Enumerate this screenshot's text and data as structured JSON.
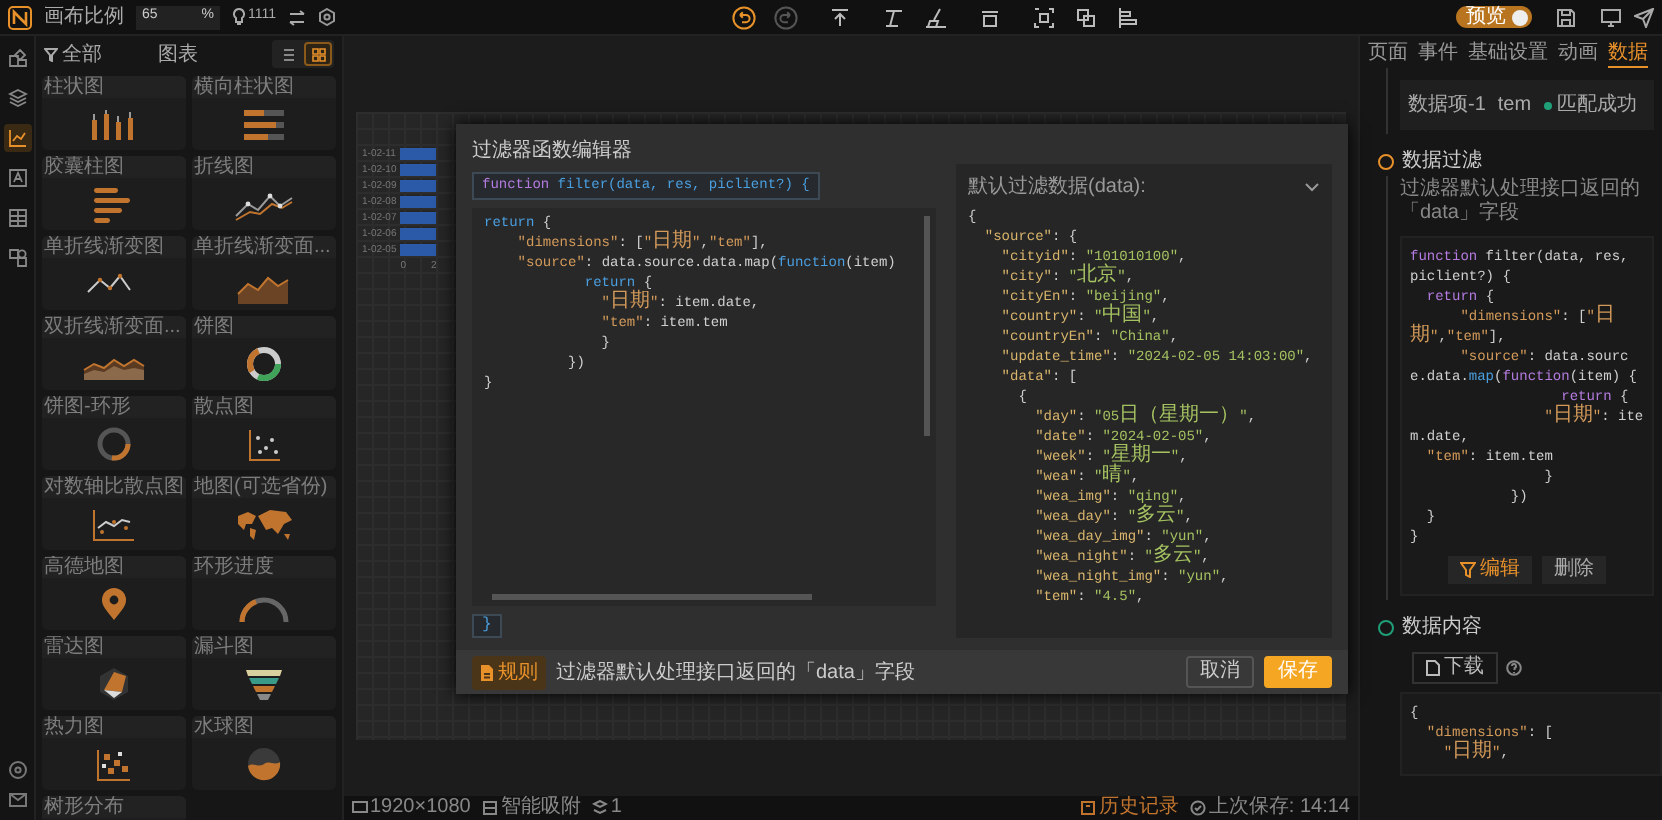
{
  "topbar": {
    "scale_label": "画布比例",
    "scale_value": "65",
    "scale_unit": "%",
    "count": "1111",
    "preview_label": "预览",
    "preview_on": true,
    "tools": [
      {
        "kind": "undo",
        "disabled": false
      },
      {
        "kind": "redo",
        "disabled": true
      },
      {
        "kind": "upload",
        "disabled": false
      },
      {
        "kind": "format",
        "disabled": false
      },
      {
        "kind": "brush",
        "disabled": false
      },
      {
        "kind": "layer",
        "disabled": false
      },
      {
        "kind": "group",
        "disabled": false
      },
      {
        "kind": "ungroup",
        "disabled": false
      },
      {
        "kind": "align",
        "disabled": false
      }
    ]
  },
  "rail": [
    {
      "kind": "blocks",
      "selected": false
    },
    {
      "kind": "layers",
      "selected": false
    },
    {
      "kind": "chart",
      "selected": true
    },
    {
      "kind": "text",
      "selected": false
    },
    {
      "kind": "table",
      "selected": false
    },
    {
      "kind": "shapes",
      "selected": false
    }
  ],
  "component_panel": {
    "filter": "全部",
    "title": "图表",
    "views": [
      {
        "kind": "list",
        "selected": false
      },
      {
        "kind": "grid",
        "selected": true
      }
    ],
    "items": [
      {
        "label": "柱状图",
        "kind": "bars"
      },
      {
        "label": "横向柱状图",
        "kind": "hbars"
      },
      {
        "label": "胶囊柱图",
        "kind": "capsule"
      },
      {
        "label": "折线图",
        "kind": "line"
      },
      {
        "label": "单折线渐变图",
        "kind": "line2"
      },
      {
        "label": "单折线渐变面...",
        "kind": "area"
      },
      {
        "label": "双折线渐变面...",
        "kind": "area2"
      },
      {
        "label": "饼图",
        "kind": "pie"
      },
      {
        "label": "饼图-环形",
        "kind": "donut"
      },
      {
        "label": "散点图",
        "kind": "scatter"
      },
      {
        "label": "对数轴比散点图",
        "kind": "scatterlog"
      },
      {
        "label": "地图(可选省份)",
        "kind": "map"
      },
      {
        "label": "高德地图",
        "kind": "pin"
      },
      {
        "label": "环形进度",
        "kind": "gauge"
      },
      {
        "label": "雷达图",
        "kind": "radar"
      },
      {
        "label": "漏斗图",
        "kind": "funnel"
      },
      {
        "label": "热力图",
        "kind": "heat"
      },
      {
        "label": "水球图",
        "kind": "ball"
      },
      {
        "label": "树形分布"
      }
    ]
  },
  "canvas_chart": {
    "labels": [
      "1-02-11",
      "1-02-10",
      "1-02-09",
      "1-02-08",
      "1-02-07",
      "1-02-06",
      "1-02-05"
    ],
    "ticks": [
      "0",
      "2"
    ]
  },
  "dialog": {
    "title": "过滤器函数编辑器",
    "signature": [
      {
        "kind": "fn",
        "text": "function"
      },
      {
        "kind": "kw",
        "text": " filter(data, res, piclient?) {"
      }
    ],
    "code": [
      [
        {
          "kind": "kw",
          "text": "return"
        },
        {
          "kind": "pl",
          "text": " {"
        }
      ],
      [
        {
          "kind": "str",
          "text": "    \"dimensions\""
        },
        {
          "kind": "pl",
          "text": ": ["
        },
        {
          "kind": "str",
          "text": "\"日期\""
        },
        {
          "kind": "pl",
          "text": ","
        },
        {
          "kind": "str",
          "text": "\"tem\""
        },
        {
          "kind": "pl",
          "text": "],"
        }
      ],
      [
        {
          "kind": "str",
          "text": "    \"source\""
        },
        {
          "kind": "pl",
          "text": ": data.source.data.map("
        },
        {
          "kind": "kw",
          "text": "function"
        },
        {
          "kind": "pl",
          "text": "(item)"
        }
      ],
      [
        {
          "kind": "kw",
          "text": "            return"
        },
        {
          "kind": "pl",
          "text": " {"
        }
      ],
      [
        {
          "kind": "str",
          "text": "              \"日期\""
        },
        {
          "kind": "pl",
          "text": ": item.date,"
        }
      ],
      [
        {
          "kind": "str",
          "text": "              \"tem\""
        },
        {
          "kind": "pl",
          "text": ": item.tem"
        }
      ],
      [
        {
          "kind": "pl",
          "text": "              }"
        }
      ],
      [
        {
          "kind": "pl",
          "text": "          })"
        }
      ],
      [
        {
          "kind": "pl",
          "text": "}"
        }
      ]
    ],
    "closing": "}",
    "data_title": "默认过滤数据(data):",
    "data_lines": [
      [
        {
          "kind": "pl",
          "text": "{"
        }
      ],
      [
        {
          "kind": "k",
          "text": "  \"source\""
        },
        {
          "kind": "pl",
          "text": ": {"
        }
      ],
      [
        {
          "kind": "k",
          "text": "    \"cityid\""
        },
        {
          "kind": "pl",
          "text": ": "
        },
        {
          "kind": "v",
          "text": "\"101010100\""
        },
        {
          "kind": "pl",
          "text": ","
        }
      ],
      [
        {
          "kind": "k",
          "text": "    \"city\""
        },
        {
          "kind": "pl",
          "text": ": "
        },
        {
          "kind": "v",
          "text": "\"北京\""
        },
        {
          "kind": "pl",
          "text": ","
        }
      ],
      [
        {
          "kind": "k",
          "text": "    \"cityEn\""
        },
        {
          "kind": "pl",
          "text": ": "
        },
        {
          "kind": "v",
          "text": "\"beijing\""
        },
        {
          "kind": "pl",
          "text": ","
        }
      ],
      [
        {
          "kind": "k",
          "text": "    \"country\""
        },
        {
          "kind": "pl",
          "text": ": "
        },
        {
          "kind": "v",
          "text": "\"中国\""
        },
        {
          "kind": "pl",
          "text": ","
        }
      ],
      [
        {
          "kind": "k",
          "text": "    \"countryEn\""
        },
        {
          "kind": "pl",
          "text": ": "
        },
        {
          "kind": "v",
          "text": "\"China\""
        },
        {
          "kind": "pl",
          "text": ","
        }
      ],
      [
        {
          "kind": "k",
          "text": "    \"update_time\""
        },
        {
          "kind": "pl",
          "text": ": "
        },
        {
          "kind": "v",
          "text": "\"2024-02-05 14:03:00\""
        },
        {
          "kind": "pl",
          "text": ","
        }
      ],
      [
        {
          "kind": "k",
          "text": "    \"data\""
        },
        {
          "kind": "pl",
          "text": ": ["
        }
      ],
      [
        {
          "kind": "pl",
          "text": "      {"
        }
      ],
      [
        {
          "kind": "k",
          "text": "        \"day\""
        },
        {
          "kind": "pl",
          "text": ": "
        },
        {
          "kind": "v",
          "text": "\"05日（星期一）\""
        },
        {
          "kind": "pl",
          "text": ","
        }
      ],
      [
        {
          "kind": "k",
          "text": "        \"date\""
        },
        {
          "kind": "pl",
          "text": ": "
        },
        {
          "kind": "v",
          "text": "\"2024-02-05\""
        },
        {
          "kind": "pl",
          "text": ","
        }
      ],
      [
        {
          "kind": "k",
          "text": "        \"week\""
        },
        {
          "kind": "pl",
          "text": ": "
        },
        {
          "kind": "v",
          "text": "\"星期一\""
        },
        {
          "kind": "pl",
          "text": ","
        }
      ],
      [
        {
          "kind": "k",
          "text": "        \"wea\""
        },
        {
          "kind": "pl",
          "text": ": "
        },
        {
          "kind": "v",
          "text": "\"晴\""
        },
        {
          "kind": "pl",
          "text": ","
        }
      ],
      [
        {
          "kind": "k",
          "text": "        \"wea_img\""
        },
        {
          "kind": "pl",
          "text": ": "
        },
        {
          "kind": "v",
          "text": "\"qing\""
        },
        {
          "kind": "pl",
          "text": ","
        }
      ],
      [
        {
          "kind": "k",
          "text": "        \"wea_day\""
        },
        {
          "kind": "pl",
          "text": ": "
        },
        {
          "kind": "v",
          "text": "\"多云\""
        },
        {
          "kind": "pl",
          "text": ","
        }
      ],
      [
        {
          "kind": "k",
          "text": "        \"wea_day_img\""
        },
        {
          "kind": "pl",
          "text": ": "
        },
        {
          "kind": "v",
          "text": "\"yun\""
        },
        {
          "kind": "pl",
          "text": ","
        }
      ],
      [
        {
          "kind": "k",
          "text": "        \"wea_night\""
        },
        {
          "kind": "pl",
          "text": ": "
        },
        {
          "kind": "v",
          "text": "\"多云\""
        },
        {
          "kind": "pl",
          "text": ","
        }
      ],
      [
        {
          "kind": "k",
          "text": "        \"wea_night_img\""
        },
        {
          "kind": "pl",
          "text": ": "
        },
        {
          "kind": "v",
          "text": "\"yun\""
        },
        {
          "kind": "pl",
          "text": ","
        }
      ],
      [
        {
          "kind": "k",
          "text": "        \"tem\""
        },
        {
          "kind": "pl",
          "text": ": "
        },
        {
          "kind": "v",
          "text": "\"4.5\""
        },
        {
          "kind": "pl",
          "text": ","
        }
      ]
    ],
    "rule_badge": "规则",
    "rule_text": "过滤器默认处理接口返回的「data」字段",
    "cancel": "取消",
    "save": "保存"
  },
  "right_panel": {
    "tabs": [
      {
        "label": "页面",
        "selected": false
      },
      {
        "label": "事件",
        "selected": false
      },
      {
        "label": "基础设置",
        "selected": false
      },
      {
        "label": "动画",
        "selected": false
      },
      {
        "label": "数据",
        "selected": true
      }
    ],
    "mapping": {
      "item": "数据项-1",
      "field": "tem",
      "status": "匹配成功",
      "matched": true
    },
    "steps": [
      {
        "title": "数据过滤",
        "color": "#e8912a"
      },
      {
        "title": "数据内容",
        "color": "#1f9e77"
      }
    ],
    "filter_desc": "过滤器默认处理接口返回的「data」字段",
    "filter_code": [
      [
        {
          "kind": "fn",
          "text": "function"
        },
        {
          "kind": "pl",
          "text": " filter(data, res, piclient?) {"
        }
      ],
      [
        {
          "kind": "fn",
          "text": "  return"
        },
        {
          "kind": "pl",
          "text": " {"
        }
      ],
      [
        {
          "kind": "str",
          "text": "      \"dimensions\""
        },
        {
          "kind": "pl",
          "text": ": ["
        },
        {
          "kind": "str",
          "text": "\"日期\""
        },
        {
          "kind": "pl",
          "text": ","
        },
        {
          "kind": "str",
          "text": "\"tem\""
        },
        {
          "kind": "pl",
          "text": "],"
        }
      ],
      [
        {
          "kind": "str",
          "text": "      \"source\""
        },
        {
          "kind": "pl",
          "text": ": data.source.data."
        },
        {
          "kind": "kw",
          "text": "map"
        },
        {
          "kind": "pl",
          "text": "("
        },
        {
          "kind": "fn",
          "text": "function"
        },
        {
          "kind": "pl",
          "text": "(item) {"
        }
      ],
      [
        {
          "kind": "fn",
          "text": "                  return"
        },
        {
          "kind": "pl",
          "text": " {"
        }
      ],
      [
        {
          "kind": "str",
          "text": "                \"日期\""
        },
        {
          "kind": "pl",
          "text": ": item.date,"
        }
      ],
      [
        {
          "kind": "str",
          "text": "  \"tem\""
        },
        {
          "kind": "pl",
          "text": ": item.tem"
        }
      ],
      [
        {
          "kind": "pl",
          "text": "                }"
        }
      ],
      [
        {
          "kind": "pl",
          "text": "            })"
        }
      ],
      [
        {
          "kind": "pl",
          "text": "  }"
        }
      ],
      [
        {
          "kind": "pl",
          "text": "}"
        }
      ]
    ],
    "edit": "编辑",
    "delete": "删除",
    "download": "下载",
    "content_lines": [
      [
        {
          "kind": "pl",
          "text": "{"
        }
      ],
      [
        {
          "kind": "str",
          "text": "  \"dimensions\""
        },
        {
          "kind": "pl",
          "text": ": ["
        }
      ],
      [
        {
          "kind": "str",
          "text": "    \"日期\""
        },
        {
          "kind": "pl",
          "text": ","
        }
      ]
    ]
  },
  "status_bar": {
    "size": "1920×1080",
    "snap": "智能吸附",
    "count": "1",
    "history": "历史记录",
    "saved": "上次保存: 14:14"
  }
}
